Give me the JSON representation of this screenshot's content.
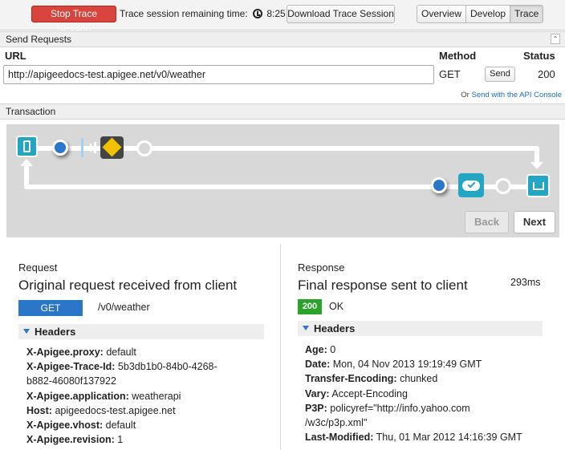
{
  "toolbar": {
    "stop_label": "Stop Trace Session",
    "remaining_label": "Trace session remaining time:",
    "remaining_value": "8:25",
    "download_label": "Download Trace Session",
    "tabs": [
      "Overview",
      "Develop",
      "Trace"
    ]
  },
  "send_requests": {
    "title": "Send Requests",
    "url_label": "URL",
    "url_value": "http://apigeedocs-test.apigee.net/v0/weather",
    "method_label": "Method",
    "method_value": "GET",
    "send_label": "Send",
    "status_label": "Status",
    "status_value": "200",
    "console_prefix": "Or",
    "console_link": "Send with the API Console"
  },
  "transaction": {
    "title": "Transaction",
    "back_label": "Back",
    "next_label": "Next"
  },
  "request": {
    "label": "Request",
    "title": "Original request received from client",
    "method": "GET",
    "path": "/v0/weather",
    "headers_title": "Headers",
    "headers": [
      {
        "name": "X-Apigee.proxy:",
        "value": "default"
      },
      {
        "name": "X-Apigee-Trace-Id:",
        "value": "5b3db1b0-84b0-4268-"
      },
      {
        "name": "",
        "value": "b882-46080f137922"
      },
      {
        "name": "X-Apigee.application:",
        "value": "weatherapi"
      },
      {
        "name": "Host:",
        "value": "apigeedocs-test.apigee.net"
      },
      {
        "name": "X-Apigee.vhost:",
        "value": "default"
      },
      {
        "name": "X-Apigee.revision:",
        "value": "1"
      }
    ]
  },
  "response": {
    "label": "Response",
    "title": "Final response sent to client",
    "time": "293ms",
    "status_code": "200",
    "status_text": "OK",
    "headers_title": "Headers",
    "headers": [
      {
        "name": "Age:",
        "value": "0"
      },
      {
        "name": "Date:",
        "value": "Mon, 04 Nov 2013 19:19:49 GMT"
      },
      {
        "name": "Transfer-Encoding:",
        "value": "chunked"
      },
      {
        "name": "Vary:",
        "value": "Accept-Encoding"
      },
      {
        "name": "P3P:",
        "value": "policyref=\"http://info.yahoo.com"
      },
      {
        "name": "",
        "value": "/w3c/p3p.xml\""
      },
      {
        "name": "Last-Modified:",
        "value": "Thu, 01 Mar 2012 14:16:39 GMT"
      }
    ]
  },
  "colors": {
    "stop": "#d9443c",
    "get_badge": "#2a77c9",
    "status_ok": "#2aa32a",
    "flow_teal": "#22a6c4",
    "policy_yellow": "#f2c200"
  },
  "icons": [
    "clock-icon",
    "collapse-icon",
    "phone-icon",
    "policy-icon",
    "cloud-check-icon",
    "server-icon",
    "triangle-down-icon"
  ]
}
